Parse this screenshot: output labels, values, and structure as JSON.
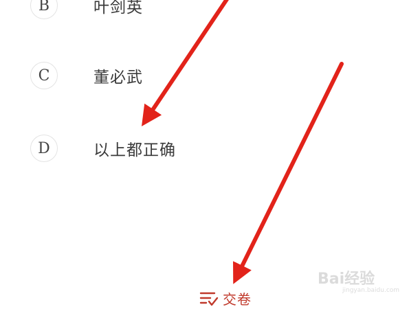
{
  "options": [
    {
      "letter": "B",
      "text": "叶剑英"
    },
    {
      "letter": "C",
      "text": "董必武"
    },
    {
      "letter": "D",
      "text": "以上都正确"
    }
  ],
  "footer": {
    "submit_label": "交卷",
    "submit_icon": "checklist-icon"
  },
  "annotations": {
    "arrow_color": "#e2231a"
  },
  "watermark": {
    "brand": "Bai经验",
    "url": "jingyan.baidu.com"
  },
  "colors": {
    "accent": "#c0392b",
    "text": "#3a3a3a",
    "circle_border": "#e3e3e3"
  }
}
